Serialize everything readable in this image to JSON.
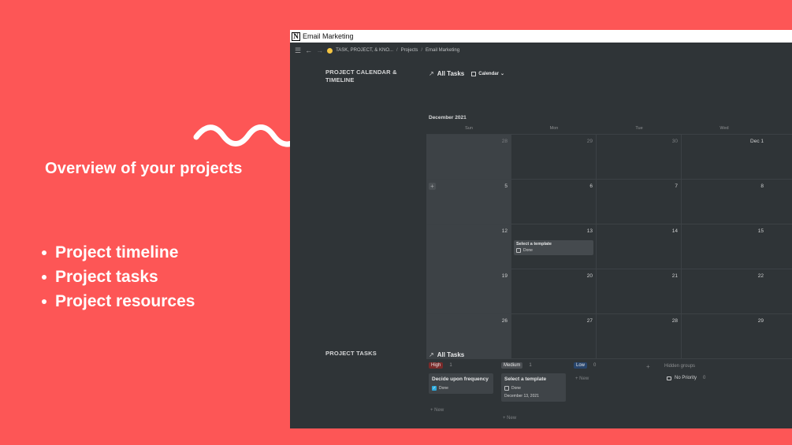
{
  "promo": {
    "headline": "Overview of your projects",
    "bullets": [
      "Project timeline",
      "Project tasks",
      "Project resources"
    ]
  },
  "window": {
    "title": "Email Marketing",
    "breadcrumb": [
      "TASK, PROJECT, & KNO...",
      "Projects",
      "Email Marketing"
    ]
  },
  "calendar_section": {
    "title_line1": "PROJECT CALENDAR &",
    "title_line2": "TIMELINE",
    "view_name": "All Tasks",
    "view_type": "Calendar",
    "month": "December 2021",
    "day_headers": [
      "Sun",
      "Mon",
      "Tue",
      "Wed"
    ],
    "weeks": [
      [
        "28",
        "29",
        "30",
        "Dec 1"
      ],
      [
        "5",
        "6",
        "7",
        "8"
      ],
      [
        "12",
        "13",
        "14",
        "15"
      ],
      [
        "19",
        "20",
        "21",
        "22"
      ],
      [
        "26",
        "27",
        "28",
        "29"
      ]
    ],
    "event": {
      "title": "Select a template",
      "status": "Done"
    }
  },
  "tasks_section": {
    "title": "PROJECT TASKS",
    "view_name": "All Tasks",
    "groups": [
      {
        "label": "High",
        "count": "1",
        "color": "#7a2a2a",
        "card_title": "Decide upon frequency",
        "card_status": "Done",
        "checked": true
      },
      {
        "label": "Medium",
        "count": "1",
        "color": "#4b4f53",
        "card_title": "Select a template",
        "card_status": "Done",
        "card_date": "December 13, 2021",
        "checked": false
      },
      {
        "label": "Low",
        "count": "0",
        "color": "#28456c"
      }
    ],
    "new_label": "+ New",
    "hidden_groups_label": "Hidden groups",
    "no_priority_label": "No Priority",
    "no_priority_count": "0"
  },
  "colors": {
    "background": "#fd5656",
    "app_bg": "#2f3437",
    "checkbox_blue": "#2eaadc"
  }
}
